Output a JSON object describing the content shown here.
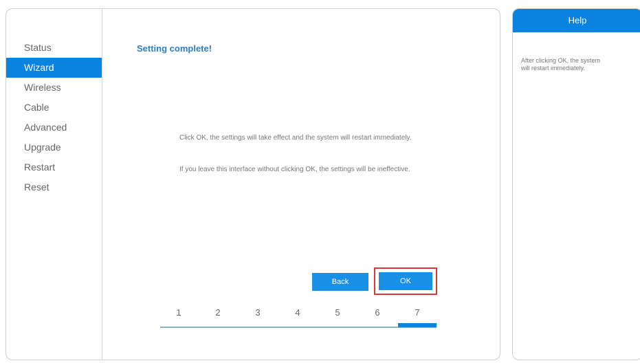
{
  "sidebar": {
    "items": [
      {
        "label": "Status",
        "active": false
      },
      {
        "label": "Wizard",
        "active": true
      },
      {
        "label": "Wireless",
        "active": false
      },
      {
        "label": "Cable",
        "active": false
      },
      {
        "label": "Advanced",
        "active": false
      },
      {
        "label": "Upgrade",
        "active": false
      },
      {
        "label": "Restart",
        "active": false
      },
      {
        "label": "Reset",
        "active": false
      }
    ]
  },
  "main": {
    "heading": "Setting complete!",
    "message1": "Click OK, the settings will take effect and the system will restart immediately.",
    "message2": "If you leave this interface without clicking OK, the settings will be ineffective.",
    "back_label": "Back",
    "ok_label": "OK"
  },
  "steps": {
    "labels": [
      "1",
      "2",
      "3",
      "4",
      "5",
      "6",
      "7"
    ],
    "current": 7
  },
  "help": {
    "title": "Help",
    "text": "After clicking OK, the system will restart immediately."
  },
  "colors": {
    "accent": "#0a84e0",
    "button": "#1a8fe6",
    "highlight_border": "#d8363a"
  }
}
